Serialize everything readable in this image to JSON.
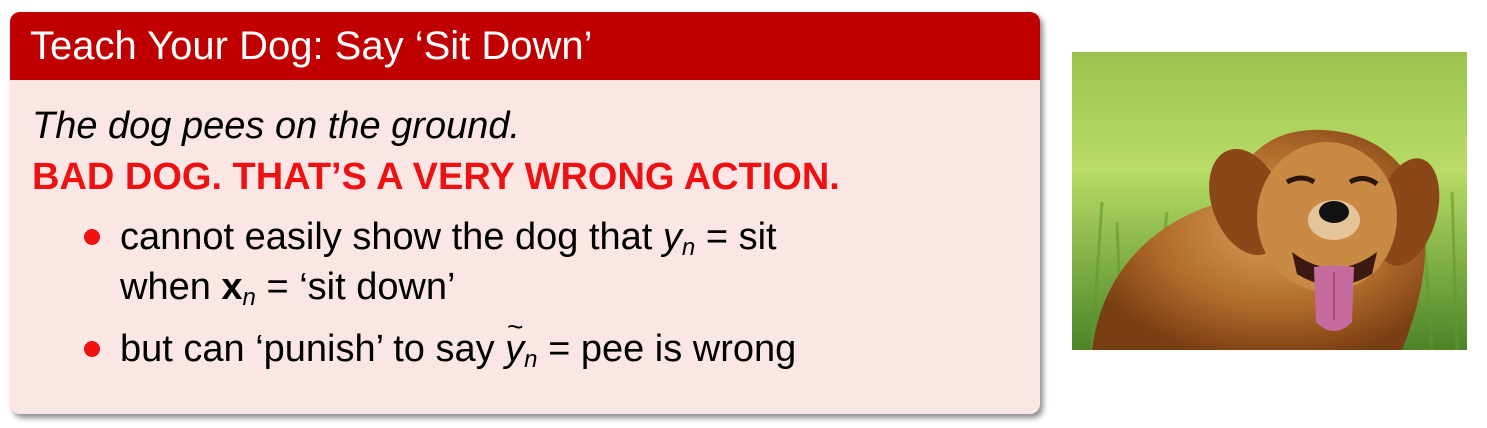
{
  "block": {
    "title": "Teach Your Dog: Say ‘Sit Down’",
    "lead": "The dog pees on the ground.",
    "alert": "BAD DOG. THAT’S A VERY WRONG ACTION.",
    "bullets": [
      {
        "line1_pre": "cannot easily show the dog that ",
        "line1_var": "y",
        "line1_sub": "n",
        "line1_post": " = sit",
        "line2_pre": "when ",
        "line2_var": "x",
        "line2_sub": "n",
        "line2_post": " = ‘sit down’"
      },
      {
        "pre": "but can ‘punish’ to say ",
        "var": "y",
        "sub": "n",
        "post": " = pee is wrong"
      }
    ]
  },
  "photo": {
    "subject": "golden-retriever-dog-photo"
  },
  "colors": {
    "title_bar": "#c00000",
    "block_bg": "#fbe6e6",
    "alert_text": "#ee1111",
    "bullet": "#ee1111"
  }
}
